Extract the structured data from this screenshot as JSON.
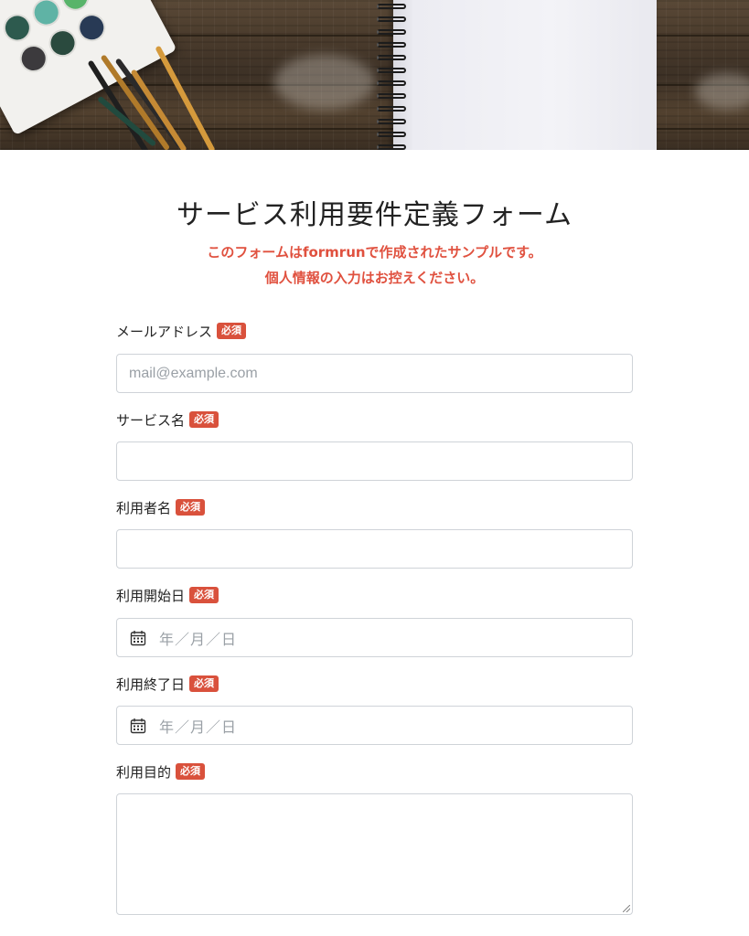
{
  "form": {
    "title": "サービス利用要件定義フォーム",
    "notice_line1": "このフォームはformrunで作成されたサンプルです。",
    "notice_line2": "個人情報の入力はお控えください。",
    "required_badge": "必須",
    "fields": {
      "email": {
        "label": "メールアドレス",
        "placeholder": "mail@example.com",
        "value": ""
      },
      "service_name": {
        "label": "サービス名",
        "value": ""
      },
      "user_name": {
        "label": "利用者名",
        "value": ""
      },
      "start_date": {
        "label": "利用開始日",
        "placeholder": "年／月／日"
      },
      "end_date": {
        "label": "利用終了日",
        "placeholder": "年／月／日"
      },
      "purpose": {
        "label": "利用目的",
        "value": ""
      }
    }
  },
  "colors": {
    "accent_red": "#d9513c",
    "notice_red": "#e0513f",
    "border": "#cfd3d8",
    "placeholder": "#9aa0a6"
  },
  "icons": {
    "date_field": "calendar-icon"
  }
}
